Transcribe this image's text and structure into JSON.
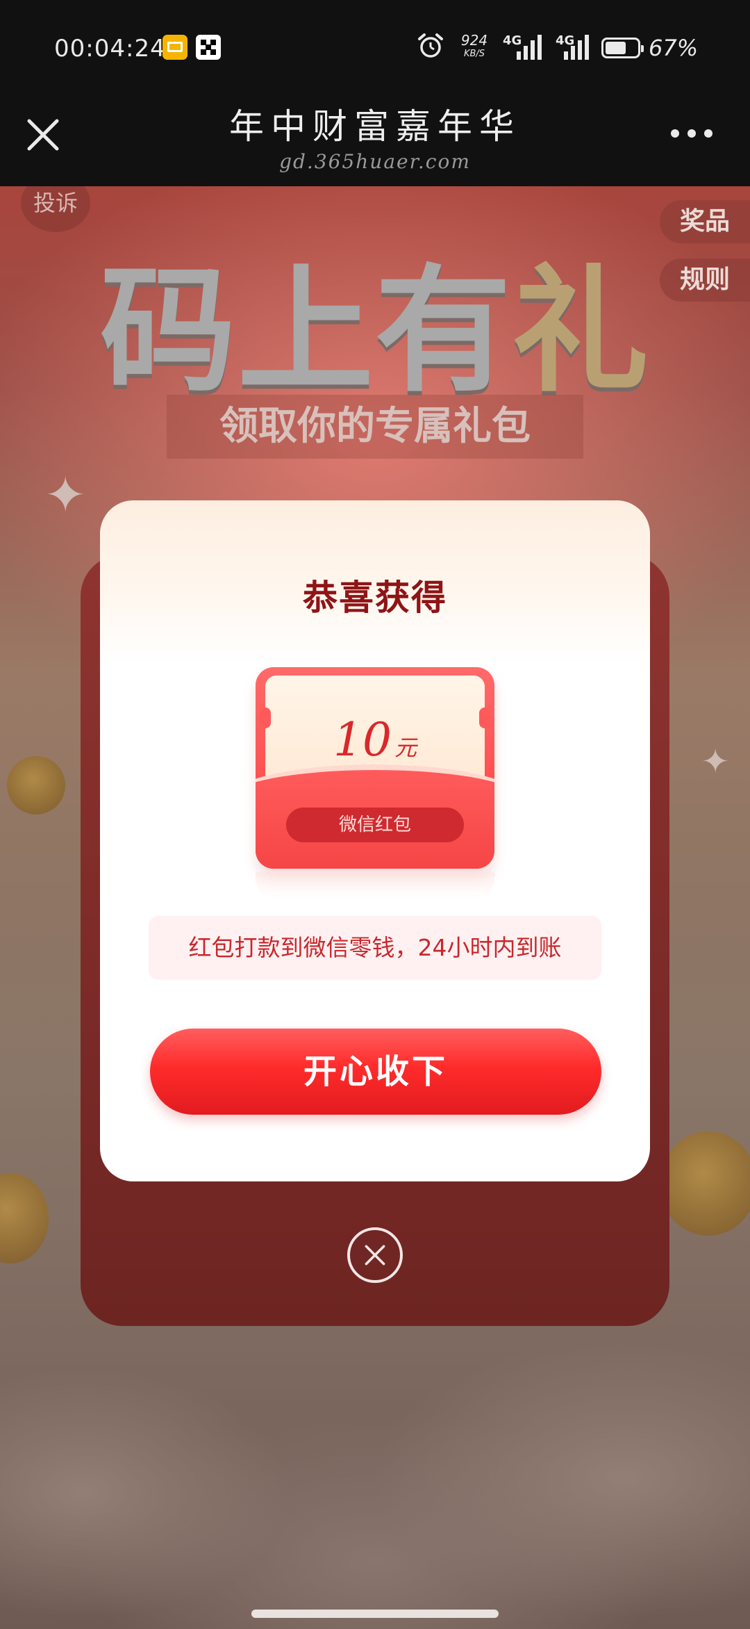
{
  "status_bar": {
    "time": "00:04:24",
    "net_speed_value": "924",
    "net_speed_unit": "KB/S",
    "signal1_label": "4G",
    "signal2_label": "4G",
    "battery_percent": "67%",
    "battery_level": 0.67
  },
  "title_bar": {
    "title": "年中财富嘉年华",
    "domain": "gd.365huaer.com"
  },
  "page": {
    "complaint_label": "投诉",
    "side_prize_label": "奖品",
    "side_rules_label": "规则",
    "hero_title_main": "码上有",
    "hero_title_accent": "礼",
    "hero_subtitle": "领取你的专属礼包"
  },
  "modal": {
    "title": "恭喜获得",
    "amount_value": "10",
    "amount_unit": "元",
    "envelope_tag": "微信红包",
    "notice_text": "红包打款到微信零钱，24小时内到账",
    "accept_button_label": "开心收下"
  },
  "colors": {
    "accent_red": "#ff2b2b",
    "title_dark_red": "#8e1416",
    "status_bg": "#111111"
  }
}
